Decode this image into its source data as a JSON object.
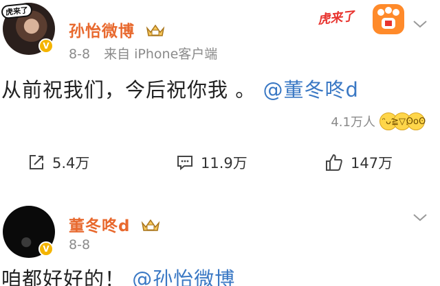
{
  "post1": {
    "avatar_tag": "虎来了",
    "author": "孙怡微博",
    "date": "8-8",
    "source": "来自 iPhone客户端",
    "promo_text": "虎来了",
    "content_text": "从前祝我们，今后祝你我 。",
    "mention": "@董冬咚d",
    "likes": "4.1万人",
    "actions": {
      "repost": "5.4万",
      "comment": "11.9万",
      "like": "147万"
    }
  },
  "post2": {
    "author": "董冬咚d",
    "date": "8-8",
    "content_text": "咱都好好的！",
    "mention": "@孙怡微博"
  },
  "colors": {
    "author_name": "#e8692e",
    "mention": "#3a78c4",
    "meta": "#8a8a8a",
    "verified_badge": "#f4b400"
  },
  "icons": [
    "crown-badge-icon",
    "verified-icon",
    "chevron-down-icon",
    "repost-icon",
    "comment-icon",
    "like-icon",
    "emoji-reaction-icon"
  ]
}
